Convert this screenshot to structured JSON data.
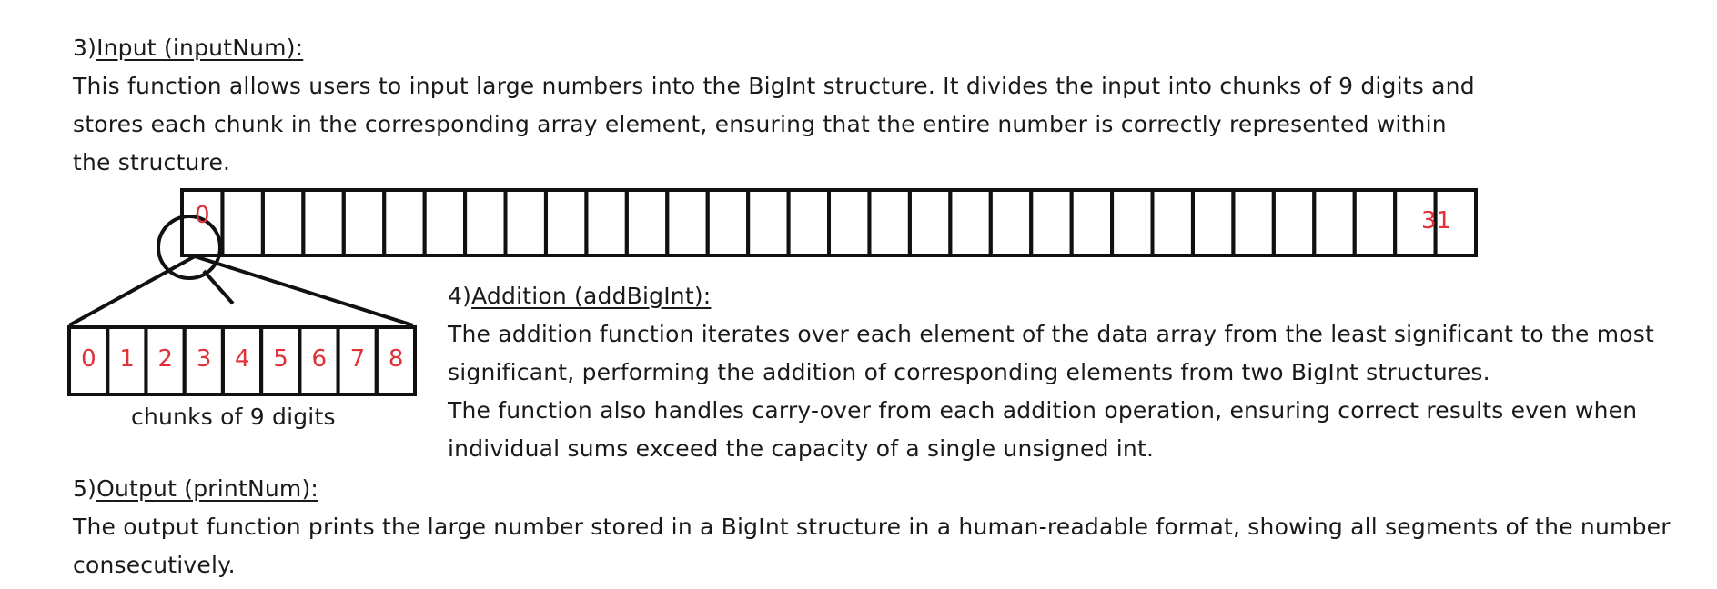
{
  "section3": {
    "prefix": "3)",
    "heading": "Input (inputNum):",
    "lines": [
      "This function allows users to input large numbers into the BigInt structure. It divides the input into chunks of 9 digits and",
      "stores each chunk in the corresponding array element, ensuring that the entire number is correctly represented within",
      "the structure."
    ]
  },
  "diagram": {
    "array_cells": 32,
    "first_index_label": "0",
    "last_index_label": "31",
    "chunk_digits": [
      "0",
      "1",
      "2",
      "3",
      "4",
      "5",
      "6",
      "7",
      "8"
    ],
    "chunk_caption": "chunks of 9 digits",
    "index_color": "#e0303a"
  },
  "section4": {
    "prefix": "4)",
    "heading": "Addition (addBigInt):",
    "lines": [
      "The addition function iterates over each element of the data array from the least significant to the most",
      "significant, performing the addition of corresponding elements from two BigInt structures.",
      "The function also handles carry-over from each addition operation, ensuring correct results even when",
      "individual sums exceed the capacity of a single unsigned int."
    ]
  },
  "section5": {
    "prefix": "5)",
    "heading": "Output (printNum):",
    "lines": [
      "The output function prints the large number stored in a BigInt structure in a human-readable format, showing all segments of the number",
      "consecutively."
    ]
  }
}
